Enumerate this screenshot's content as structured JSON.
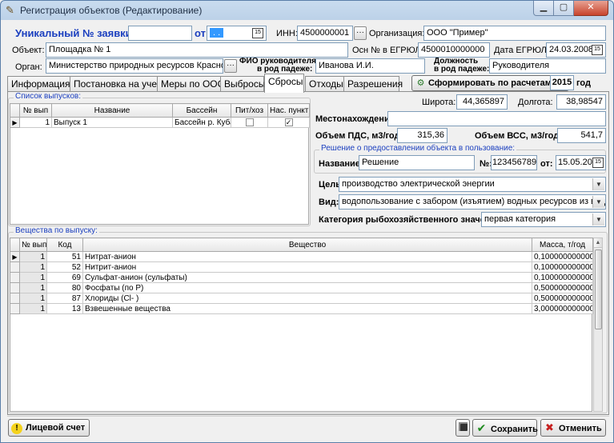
{
  "window": {
    "title": "Регистрация объектов (Редактирование)"
  },
  "header": {
    "app_no_label": "Уникальный № заявки:",
    "app_no_value": "",
    "from_label": "от",
    "from_value": ". .",
    "inn_label": "ИНН:",
    "inn_value": "4500000001",
    "org_label": "Организация:",
    "org_value": "ООО \"Пример\"",
    "object_label": "Объект:",
    "object_value": "Площадка № 1",
    "ogrn_label": "Осн № в ЕГРЮЛ:",
    "ogrn_value": "4500010000000",
    "egrul_date_label": "Дата ЕГРЮЛ:",
    "egrul_date_value": "24.03.2008",
    "organ_label": "Орган:",
    "organ_value": "Министерство природных ресурсов Краснода",
    "fio_label_1": "ФИО руководителя",
    "fio_label_2": "в род падеже:",
    "fio_value": "Иванова И.И.",
    "position_label_1": "Должность",
    "position_label_2": "в род падеже:",
    "position_value": "Руководителя",
    "ellipsis": "···"
  },
  "tabs": [
    {
      "label": "Информация"
    },
    {
      "label": "Постановка на учет"
    },
    {
      "label": "Меры по ООС"
    },
    {
      "label": "Выбросы"
    },
    {
      "label": "Сбросы"
    },
    {
      "label": "Отходы"
    },
    {
      "label": "Разрешения"
    }
  ],
  "calc": {
    "label": "Сформировать по расчетам за:",
    "year": "2015",
    "year_suffix": "год"
  },
  "releases": {
    "title": "Список выпусков:",
    "columns": [
      "№ вып",
      "Название",
      "Бассейн",
      "Пит/хоз",
      "Нас. пункт"
    ],
    "rows": [
      {
        "no": "1",
        "name": "Выпуск 1",
        "basin": "Бассейн р. Кубан",
        "pit": "",
        "nas": "✓"
      }
    ]
  },
  "coords": {
    "lat_label": "Широта:",
    "lat_value": "44,365897",
    "lon_label": "Долгота:",
    "lon_value": "38,98547"
  },
  "location": {
    "label": "Местонахождение:",
    "value": ""
  },
  "volumes": {
    "pds_label": "Объем ПДС, м3/год:",
    "pds_value": "315,36",
    "vss_label": "Объем ВСС, м3/год:",
    "vss_value": "541,7"
  },
  "decision": {
    "title": "Решение о предоставлении объекта в пользование:",
    "name_label": "Название:",
    "name_value": "Решение",
    "no_label": "№:",
    "no_value": "123456789(",
    "from_label": "от:",
    "from_value": "15.05.2015"
  },
  "purpose": {
    "label": "Цель:",
    "value": "производство электрической энергии"
  },
  "kind": {
    "label": "Вид:",
    "value": "водопользование с забором (изъятием) водных ресурсов из вод"
  },
  "fish_category": {
    "label": "Категория рыбохозяйственного значения:",
    "value": "первая категория"
  },
  "substances": {
    "title": "Вещества по выпуску:",
    "columns": [
      "№ вып",
      "Код",
      "Вещество",
      "Масса, т/год"
    ],
    "rows": [
      {
        "no": "1",
        "code": "51",
        "name": "Нитрат-анион",
        "mass": "0,100000000000"
      },
      {
        "no": "1",
        "code": "52",
        "name": "Нитрит-анион",
        "mass": "0,100000000000"
      },
      {
        "no": "1",
        "code": "69",
        "name": "Сульфат-анион (сульфаты)",
        "mass": "0,100000000000"
      },
      {
        "no": "1",
        "code": "80",
        "name": "Фосфаты (по Р)",
        "mass": "0,500000000000"
      },
      {
        "no": "1",
        "code": "87",
        "name": "Хлориды (Cl- )",
        "mass": "0,500000000000"
      },
      {
        "no": "1",
        "code": "13",
        "name": "Взвешенные вещества",
        "mass": "3,000000000000"
      }
    ]
  },
  "footer": {
    "account_label": "Лицевой счет",
    "save_label": "Сохранить",
    "cancel_label": "Отменить"
  },
  "colors": {
    "title_blue": "#1b3fbf",
    "selection": "#3399ff",
    "close_red": "#c8442d"
  }
}
